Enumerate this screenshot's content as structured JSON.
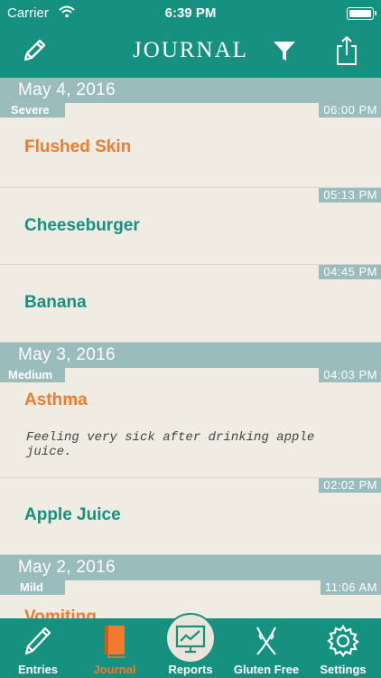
{
  "status": {
    "carrier": "Carrier",
    "time": "6:39 PM"
  },
  "nav": {
    "title": "JOURNAL"
  },
  "days": [
    {
      "date": "May 4, 2016",
      "entries": [
        {
          "severity": "Severe",
          "time": "06:00 PM",
          "name": "Flushed Skin",
          "kind": "symptom"
        },
        {
          "time": "05:13 PM",
          "name": "Cheeseburger",
          "kind": "food"
        },
        {
          "time": "04:45 PM",
          "name": "Banana",
          "kind": "food"
        }
      ]
    },
    {
      "date": "May 3, 2016",
      "entries": [
        {
          "severity": "Medium",
          "time": "04:03 PM",
          "name": "Asthma",
          "kind": "symptom",
          "note": "Feeling very sick after drinking apple juice."
        },
        {
          "time": "02:02 PM",
          "name": "Apple Juice",
          "kind": "food"
        }
      ]
    },
    {
      "date": "May 2, 2016",
      "entries": [
        {
          "severity": "Mild",
          "time": "11:06 AM",
          "name": "Vomiting",
          "kind": "symptom"
        }
      ]
    }
  ],
  "tabs": [
    {
      "label": "Entries",
      "icon": "pencil-icon"
    },
    {
      "label": "Journal",
      "icon": "book-icon",
      "active": true
    },
    {
      "label": "Reports",
      "icon": "chart-icon"
    },
    {
      "label": "Gluten Free",
      "icon": "wheat-icon"
    },
    {
      "label": "Settings",
      "icon": "gear-icon"
    }
  ],
  "colors": {
    "teal": "#16907f",
    "orange": "#f07b2c",
    "header": "#9bbcbd",
    "paper": "#efece4"
  }
}
